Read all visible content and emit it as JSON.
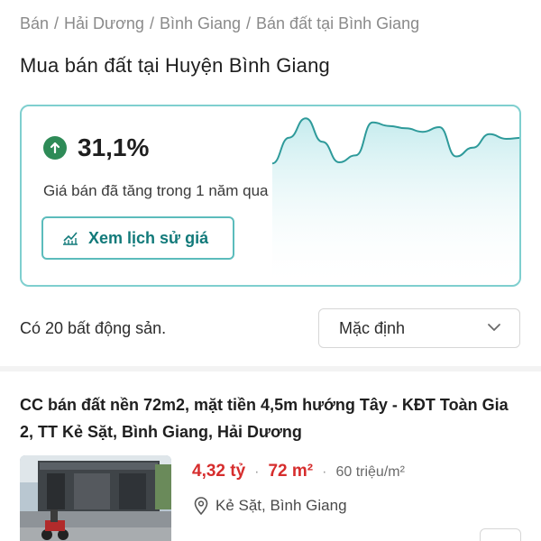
{
  "breadcrumb": [
    "Bán",
    "Hải Dương",
    "Bình Giang",
    "Bán đất tại Bình Giang"
  ],
  "page_title": "Mua bán đất tại Huyện Bình Giang",
  "price_trend": {
    "change_percent": "31,1%",
    "caption": "Giá bán đã tăng trong 1 năm qua",
    "history_button": "Xem lịch sử giá",
    "accent_color": "#2e9a9a",
    "up_color": "#2e8b57",
    "sparkline": [
      0.18,
      0.62,
      0.95,
      0.55,
      0.2,
      0.32,
      0.88,
      0.82,
      0.78,
      0.72,
      0.8,
      0.3,
      0.45,
      0.68,
      0.6,
      0.62
    ]
  },
  "results": {
    "count_text": "Có 20 bất động sản.",
    "sort_value": "Mặc định"
  },
  "listing": {
    "title": "CC bán đất nền 72m2, mặt tiền 4,5m hướng Tây - KĐT Toàn Gia 2, TT Kẻ Sặt, Bình Giang, Hải Dương",
    "price": "4,32 tỷ",
    "area": "72 m²",
    "price_per_m2": "60 triệu/m²",
    "location": "Kẻ Sặt, Bình Giang",
    "price_color": "#d62d2d"
  },
  "icons": {
    "trend_up": "arrow-up-circle-icon",
    "history": "chart-line-icon",
    "dropdown": "chevron-down-icon",
    "location": "map-pin-icon"
  }
}
